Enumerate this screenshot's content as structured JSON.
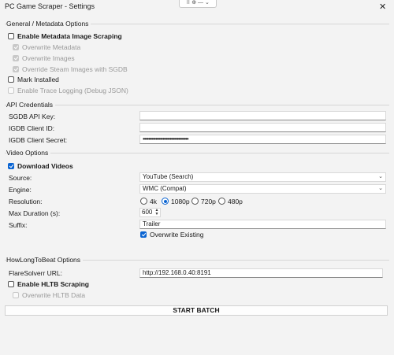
{
  "window": {
    "title": "PC Game Scraper - Settings",
    "snap_icons": "⠿ ⊕ — ⌄",
    "close_glyph": "✕"
  },
  "general": {
    "title": "General / Metadata Options",
    "enable_metadata": {
      "label": "Enable Metadata  Image Scraping",
      "checked": false
    },
    "overwrite_metadata": {
      "label": "Overwrite Metadata",
      "checked": true
    },
    "overwrite_images": {
      "label": "Overwrite Images",
      "checked": true
    },
    "override_steam": {
      "label": "Override Steam Images with SGDB",
      "checked": true
    },
    "mark_installed": {
      "label": "Mark Installed",
      "checked": false
    },
    "trace_logging": {
      "label": "Enable Trace Logging (Debug JSON)",
      "checked": false
    }
  },
  "api": {
    "title": "API Credentials",
    "sgdb_label": "SGDB API Key:",
    "sgdb_value": "",
    "igdb_id_label": "IGDB Client ID:",
    "igdb_id_value": "",
    "igdb_secret_label": "IGDB Client Secret:",
    "igdb_secret_value": "••••••••••••••••••••••••••••••••"
  },
  "video": {
    "title": "Video Options",
    "download_label": "Download Videos",
    "download_checked": true,
    "source_label": "Source:",
    "source_value": "YouTube (Search)",
    "engine_label": "Engine:",
    "engine_value": "WMC (Compat)",
    "resolution_label": "Resolution:",
    "resolutions": [
      "4k",
      "1080p",
      "720p",
      "480p"
    ],
    "resolution_selected": "1080p",
    "max_duration_label": "Max Duration (s):",
    "max_duration_value": "600",
    "suffix_label": "Suffix:",
    "suffix_value": "Trailer",
    "overwrite_label": "Overwrite Existing",
    "overwrite_checked": true
  },
  "hltb": {
    "title": "HowLongToBeat Options",
    "flaresolverr_label": "FlareSolverr URL:",
    "flaresolverr_value": "http://192.168.0.40:8191",
    "enable_label": "Enable HLTB Scraping",
    "enable_checked": false,
    "overwrite_label": "Overwrite HLTB Data",
    "overwrite_checked": false
  },
  "start_button": "START BATCH"
}
